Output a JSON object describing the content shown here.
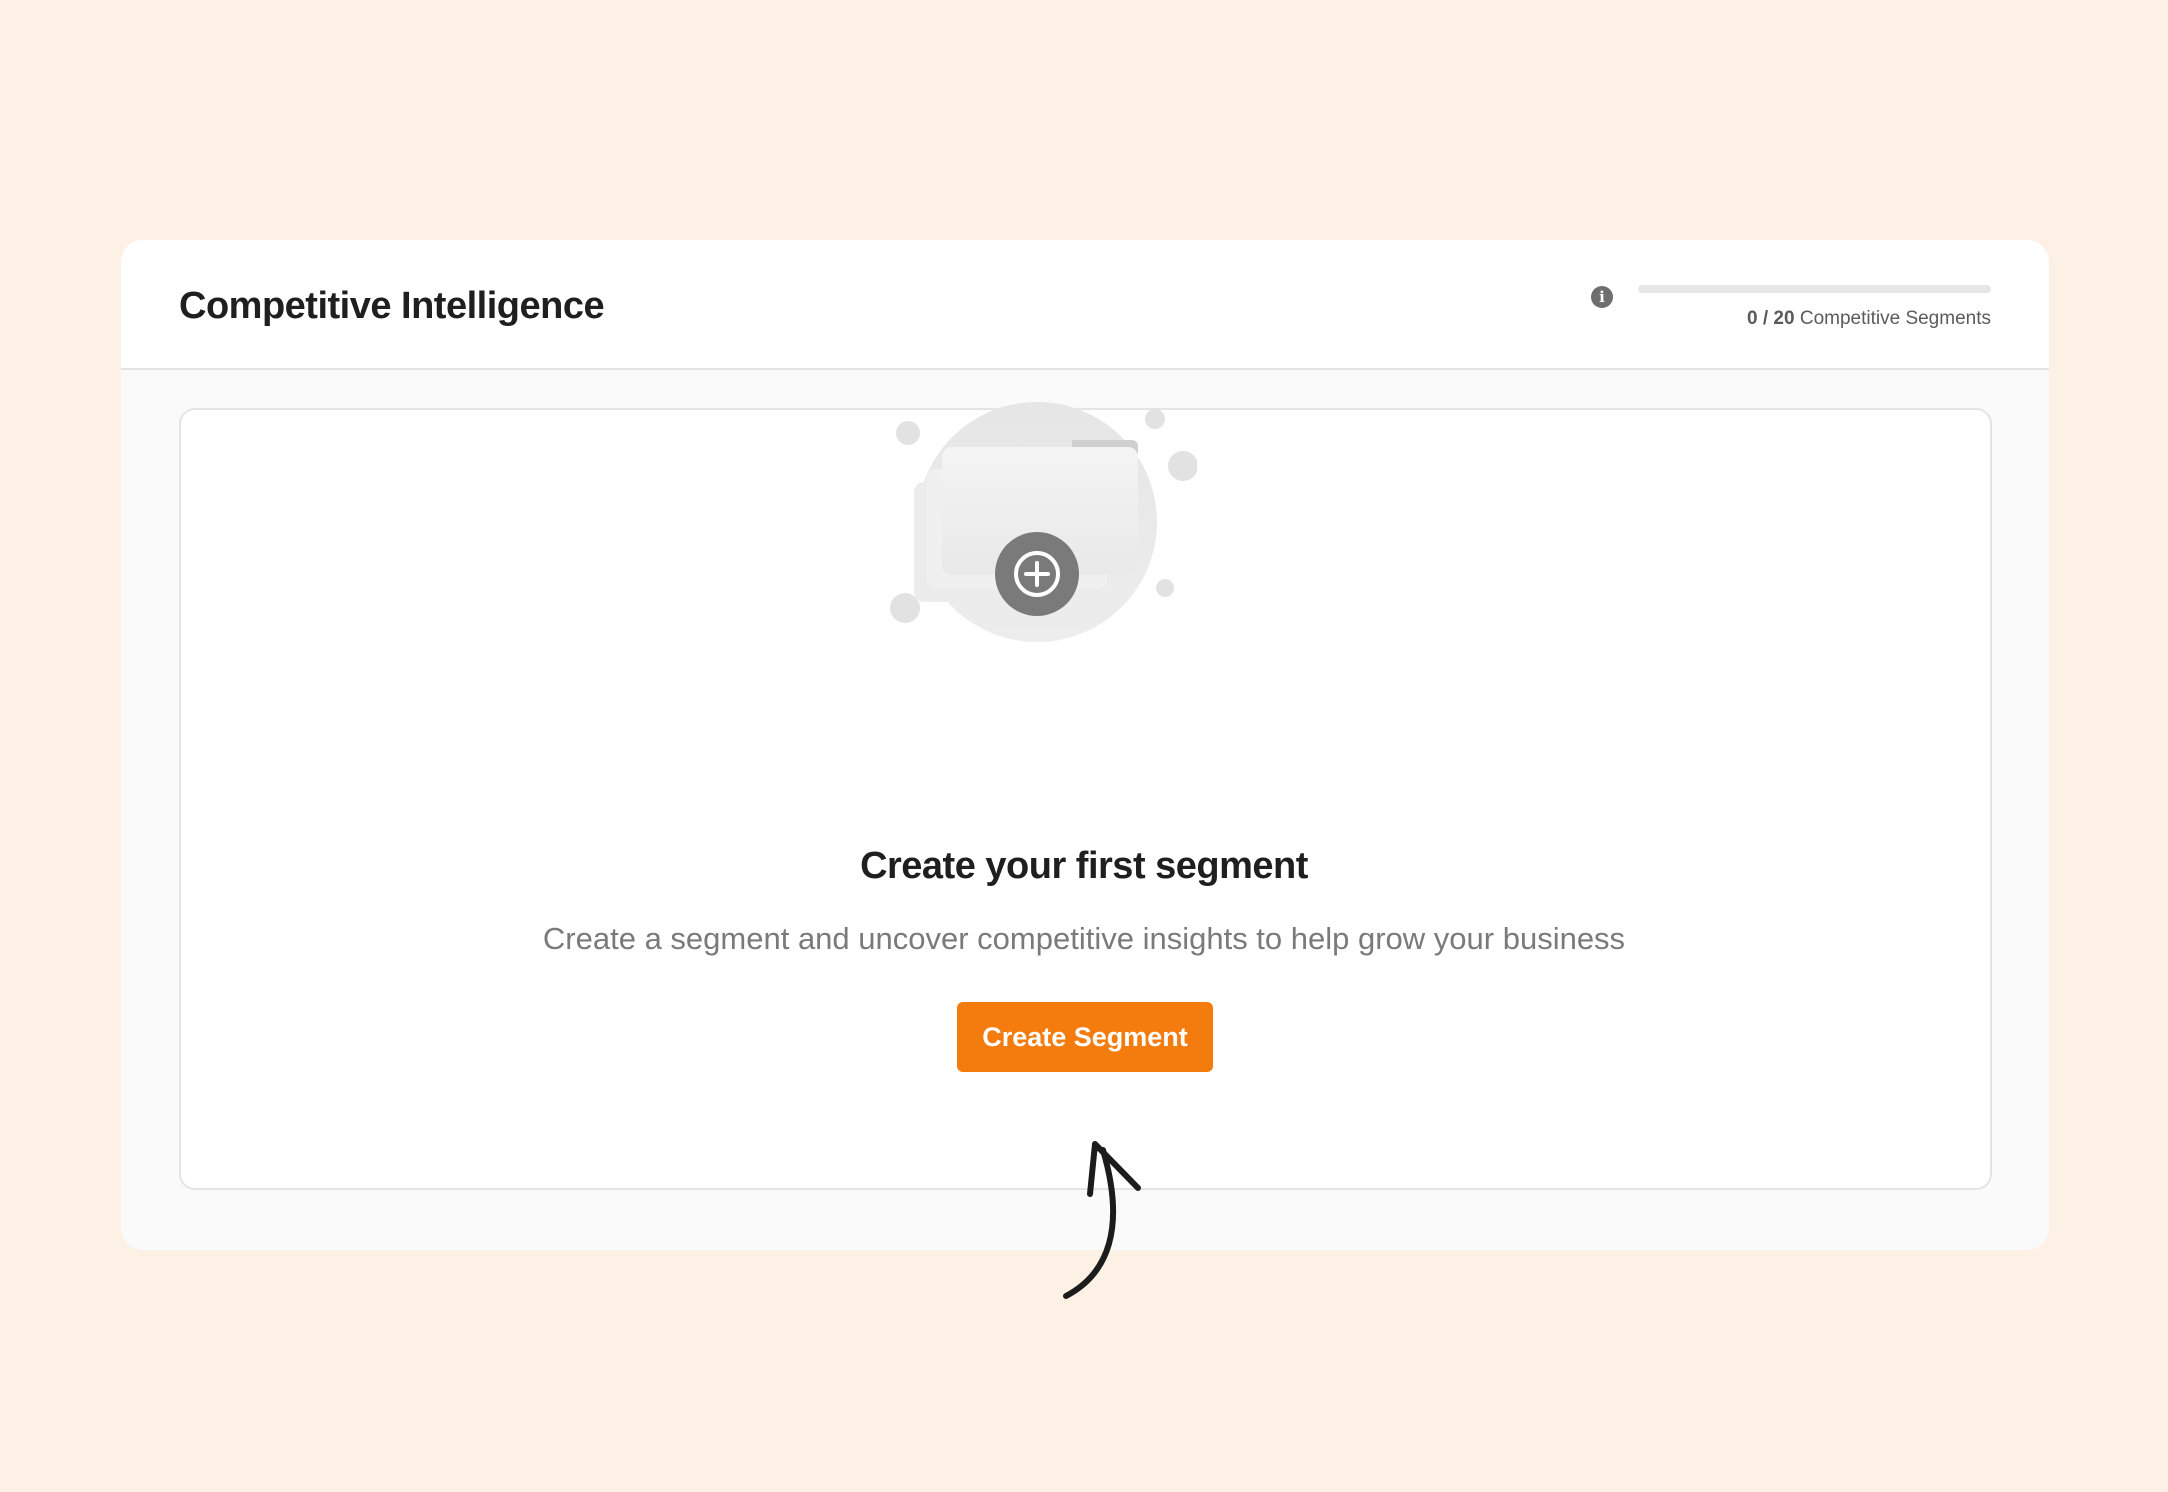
{
  "header": {
    "title": "Competitive Intelligence"
  },
  "usage": {
    "info_icon": "info-icon",
    "count": "0 / 20",
    "label": "Competitive Segments",
    "used": 0,
    "limit": 20,
    "fill_fraction": 0
  },
  "empty_state": {
    "illustration_icon": "add-folder-icon",
    "heading": "Create your first segment",
    "description": "Create a segment and uncover competitive insights to help grow your business",
    "button_label": "Create Segment"
  },
  "colors": {
    "page_background": "#fdf1e5",
    "accent": "#f47c0e",
    "progress_track": "#e7e7e7"
  }
}
